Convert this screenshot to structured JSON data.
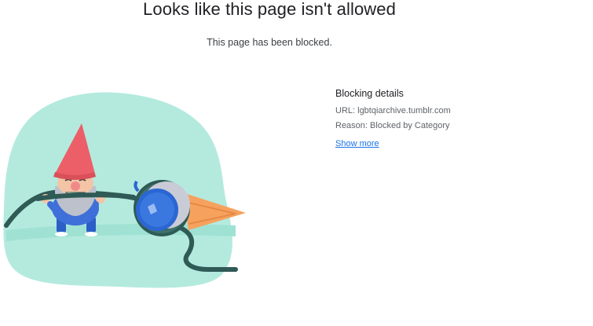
{
  "page": {
    "title": "Looks like this page isn't allowed",
    "subtitle": "This page has been blocked."
  },
  "details": {
    "heading": "Blocking details",
    "url_label": "URL:",
    "url_value": "lgbtqiarchive.tumblr.com",
    "reason_label": "Reason:",
    "reason_value": "Blocked by Category",
    "show_more": "Show more"
  },
  "illustration": {
    "icon": "gnome-pulling-cable-icon"
  },
  "colors": {
    "blob": "#b4eade",
    "ground": "#9fe2d3",
    "cable": "#2f5a55",
    "gnome_hat": "#ec5f68",
    "gnome_body": "#3f6fd8",
    "plug": "#2b66d3",
    "cone": "#f6a25e",
    "link": "#1a73e8"
  }
}
